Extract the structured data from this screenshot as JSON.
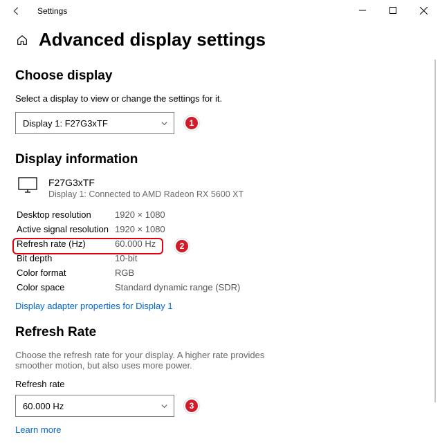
{
  "titlebar": {
    "app": "Settings"
  },
  "page": {
    "title": "Advanced display settings"
  },
  "choose": {
    "heading": "Choose display",
    "desc": "Select a display to view or change the settings for it.",
    "selected": "Display 1: F27G3xTF"
  },
  "info": {
    "heading": "Display information",
    "monitor_name": "F27G3xTF",
    "monitor_sub": "Display 1: Connected to AMD Radeon RX 5600 XT",
    "rows": [
      {
        "label": "Desktop resolution",
        "value": "1920 × 1080"
      },
      {
        "label": "Active signal resolution",
        "value": "1920 × 1080"
      },
      {
        "label": "Refresh rate (Hz)",
        "value": "60.000 Hz"
      },
      {
        "label": "Bit depth",
        "value": "10-bit"
      },
      {
        "label": "Color format",
        "value": "RGB"
      },
      {
        "label": "Color space",
        "value": "Standard dynamic range (SDR)"
      }
    ],
    "link": "Display adapter properties for Display 1"
  },
  "refresh": {
    "heading": "Refresh Rate",
    "desc": "Choose the refresh rate for your display. A higher rate provides smoother motion, but also uses more power.",
    "label": "Refresh rate",
    "selected": "60.000 Hz",
    "learn": "Learn more"
  },
  "badges": {
    "b1": "1",
    "b2": "2",
    "b3": "3"
  }
}
